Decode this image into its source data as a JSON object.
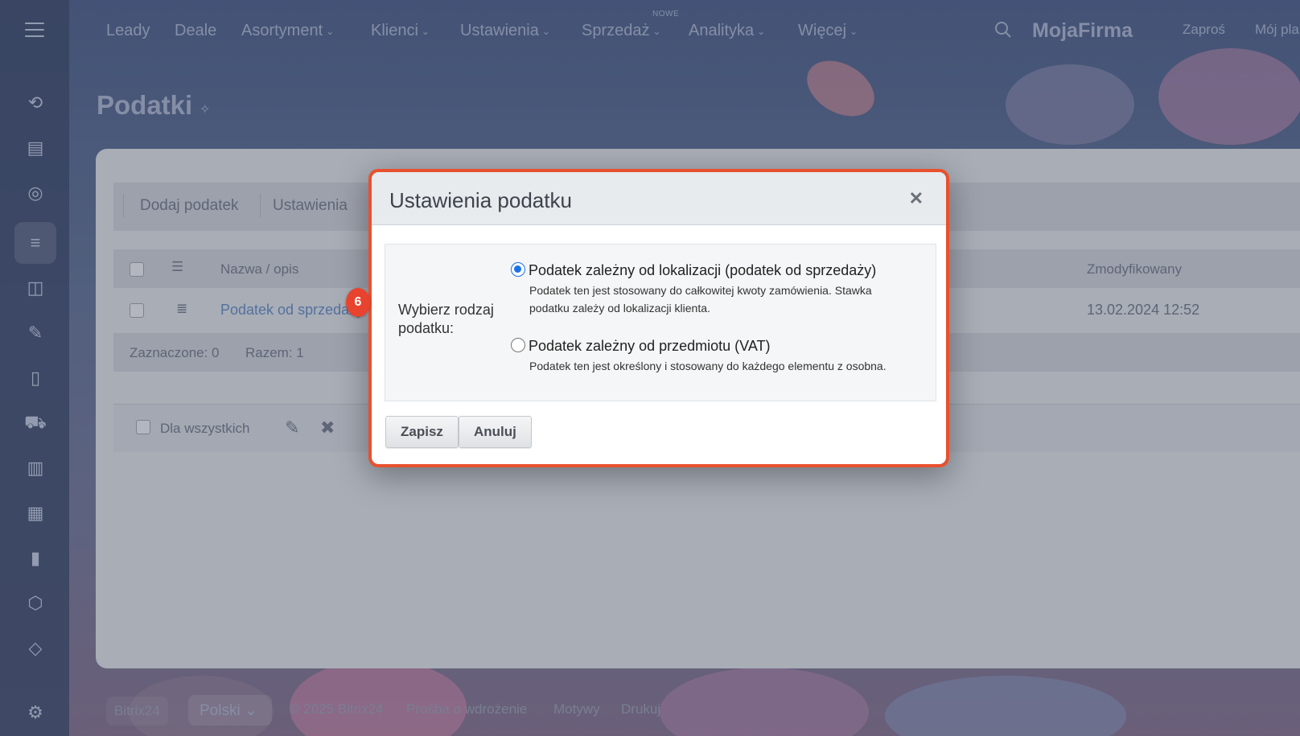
{
  "nav": {
    "items": [
      {
        "label": "Leady"
      },
      {
        "label": "Deale"
      },
      {
        "label": "Asortyment"
      },
      {
        "label": "Klienci"
      },
      {
        "label": "Ustawienia"
      },
      {
        "label": "Sprzedaż"
      },
      {
        "label": "Analityka"
      },
      {
        "label": "Więcej"
      }
    ],
    "new_badge": "NOWE",
    "brand": "MojaFirma",
    "invite": "Zaproś",
    "my_plan": "Mój pla"
  },
  "page": {
    "title": "Podatki"
  },
  "toolbar": {
    "add_label": "Dodaj podatek",
    "settings_label": "Ustawienia"
  },
  "grid": {
    "columns": {
      "name": "Nazwa / opis",
      "modified": "Zmodyfikowany"
    },
    "rows": [
      {
        "name": "Podatek od sprzedaży",
        "modified": "13.02.2024 12:52"
      }
    ],
    "footer": {
      "selected": "Zaznaczone: 0",
      "total": "Razem: 1"
    },
    "actions": {
      "for_all": "Dla wszystkich"
    }
  },
  "dialog": {
    "title": "Ustawienia podatku",
    "choose_label": "Wybierz rodzaj podatku:",
    "options": [
      {
        "title": "Podatek zależny od lokalizacji (podatek od sprzedaży)",
        "description": "Podatek ten jest stosowany do całkowitej kwoty zamówienia. Stawka podatku zależy od lokalizacji klienta.",
        "checked": true
      },
      {
        "title": "Podatek zależny od przedmiotu (VAT)",
        "description": "Podatek ten jest określony i stosowany do każdego elementu z osobna.",
        "checked": false
      }
    ],
    "save_label": "Zapisz",
    "cancel_label": "Anuluj"
  },
  "step_badge": "6",
  "footer": {
    "bitrix": "Bitrix24",
    "language": "Polski",
    "copyright": "© 2025 Bitrix24",
    "implementation": "Prośba o wdrożenie",
    "themes": "Motywy",
    "print": "Drukuj"
  },
  "colors": {
    "accent": "#e8512e",
    "radio": "#1a73e8"
  }
}
